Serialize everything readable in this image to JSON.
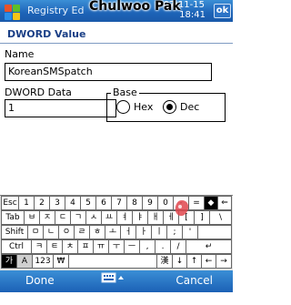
{
  "titlebar": {
    "app_title": "Registry Ed",
    "watermark": "Chulwoo Pak",
    "date": "07-11-15",
    "time": "18:41",
    "ok_label": "ok"
  },
  "dialog": {
    "title": "DWORD Value",
    "name_label": "Name",
    "name_value": "KoreanSMSpatch",
    "data_label": "DWORD Data",
    "data_value": "1",
    "base_label": "Base",
    "hex_label": "Hex",
    "dec_label": "Dec",
    "selected_base": "Dec"
  },
  "keyboard": {
    "row1": [
      "Esc",
      "1",
      "2",
      "3",
      "4",
      "5",
      "6",
      "7",
      "8",
      "9",
      "0",
      "-",
      "=",
      "◆"
    ],
    "row2": [
      "Tab",
      "ㅂ",
      "ㅈ",
      "ㄷ",
      "ㄱ",
      "ㅅ",
      "ㅛ",
      "ㅕ",
      "ㅑ",
      "ㅐ",
      "ㅔ",
      "[",
      "]"
    ],
    "row3": [
      "Shift",
      "ㅁ",
      "ㄴ",
      "ㅇ",
      "ㄹ",
      "ㅎ",
      "ㅗ",
      "ㅓ",
      "ㅏ",
      "ㅣ",
      ";",
      "'"
    ],
    "row4": [
      "Ctrl",
      "ㅋ",
      "ㅌ",
      "ㅊ",
      "ㅍ",
      "ㅠ",
      "ㅜ",
      "ㅡ",
      ",",
      ".",
      "/",
      "↵"
    ],
    "row5": [
      "가",
      "A",
      "123",
      "₩",
      "",
      "漢",
      "↓",
      "↑",
      "←",
      "→"
    ]
  },
  "menubar": {
    "left_label": "Done",
    "right_label": "Cancel"
  }
}
